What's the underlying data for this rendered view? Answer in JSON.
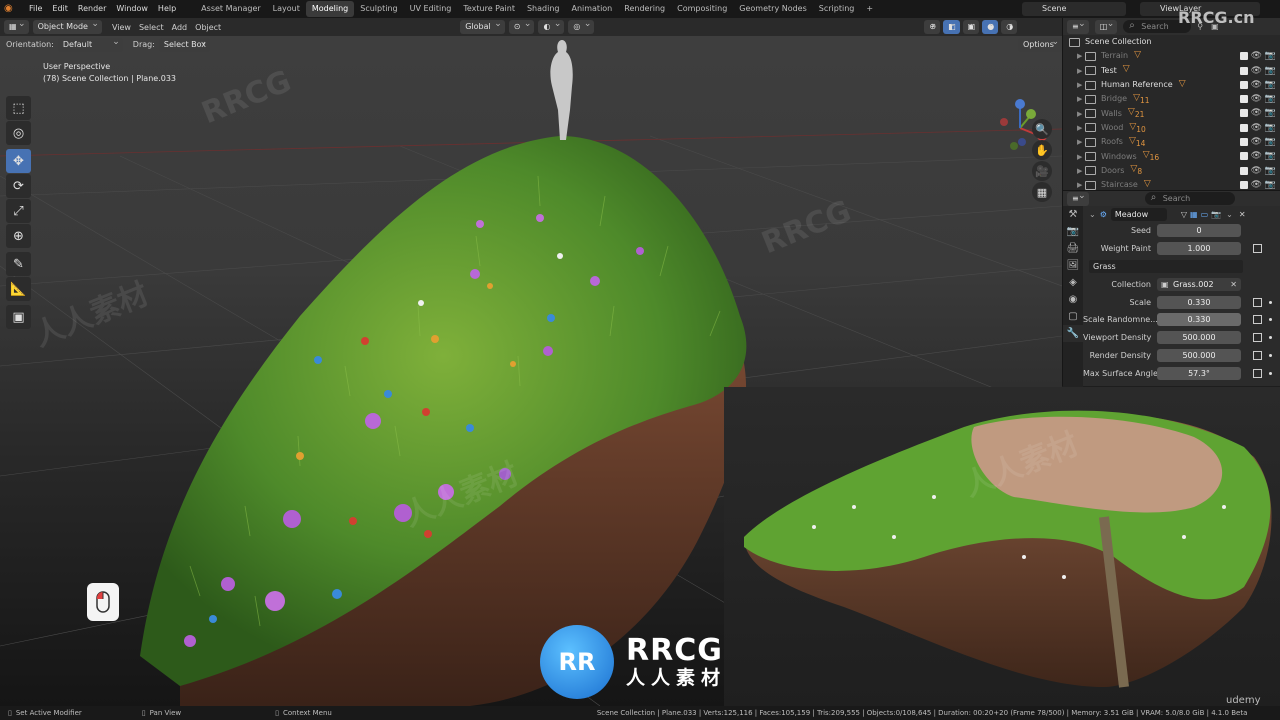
{
  "menu": [
    "File",
    "Edit",
    "Render",
    "Window",
    "Help"
  ],
  "workspaces": [
    "Asset Manager",
    "Layout",
    "Modeling",
    "Sculpting",
    "UV Editing",
    "Texture Paint",
    "Shading",
    "Animation",
    "Rendering",
    "Compositing",
    "Geometry Nodes",
    "Scripting"
  ],
  "active_workspace": "Modeling",
  "scene_name": "Scene",
  "view_layer": "ViewLayer",
  "header": {
    "mode": "Object Mode",
    "menus": [
      "View",
      "Select",
      "Add",
      "Object"
    ],
    "transform_orientation": "Global",
    "orientation_label": "Orientation:",
    "orientation_value": "Default",
    "drag_label": "Drag:",
    "drag_value": "Select Box",
    "options": "Options"
  },
  "viewport": {
    "view_name": "User Perspective",
    "collection_path": "(78) Scene Collection | Plane.033"
  },
  "outliner": {
    "search_placeholder": "Search",
    "root": "Scene Collection",
    "items": [
      {
        "name": "Terrain",
        "dim": true,
        "count": ""
      },
      {
        "name": "Test",
        "dim": false,
        "count": ""
      },
      {
        "name": "Human Reference",
        "dim": false,
        "count": ""
      },
      {
        "name": "Bridge",
        "dim": true,
        "count": "11"
      },
      {
        "name": "Walls",
        "dim": true,
        "count": "21"
      },
      {
        "name": "Wood",
        "dim": true,
        "count": "10"
      },
      {
        "name": "Roofs",
        "dim": true,
        "count": "14"
      },
      {
        "name": "Windows",
        "dim": true,
        "count": "16"
      },
      {
        "name": "Doors",
        "dim": true,
        "count": "8"
      },
      {
        "name": "Staircase",
        "dim": true,
        "count": ""
      }
    ]
  },
  "properties": {
    "search_placeholder": "Search",
    "modifier_name": "Meadow",
    "seed_label": "Seed",
    "seed": "0",
    "weight_label": "Weight Paint",
    "weight": "1.000",
    "group": "Grass",
    "collection_label": "Collection",
    "collection": "Grass.002",
    "scale_label": "Scale",
    "scale": "0.330",
    "scale_rand_label": "Scale Randomne...",
    "scale_rand": "0.330",
    "vp_density_label": "Viewport Density",
    "vp_density": "500.000",
    "render_density_label": "Render Density",
    "render_density": "500.000",
    "max_angle_label": "Max Surface Angle",
    "max_angle": "57.3°"
  },
  "status": {
    "left1": "Set Active Modifier",
    "left2": "Pan View",
    "left3": "Context Menu",
    "stats": "Scene Collection | Plane.033 | Verts:125,116 | Faces:105,159 | Tris:209,555 | Objects:0/108,645 | Duration: 00:20+20 (Frame 78/500) | Memory: 3.51 GiB | VRAM: 5.0/8.0 GiB | 4.1.0 Beta"
  },
  "watermark": {
    "corner": "RRCG.cn",
    "logo_main": "RRCG",
    "logo_sub": "人人素材",
    "logo_mark": "RR",
    "udemy": "udemy",
    "diagonal": [
      "RRCG",
      "人人素材"
    ]
  },
  "colors": {
    "accent_blue": "#4772b3",
    "grass": "#4e8a2a",
    "soil": "#6b3f2c"
  }
}
